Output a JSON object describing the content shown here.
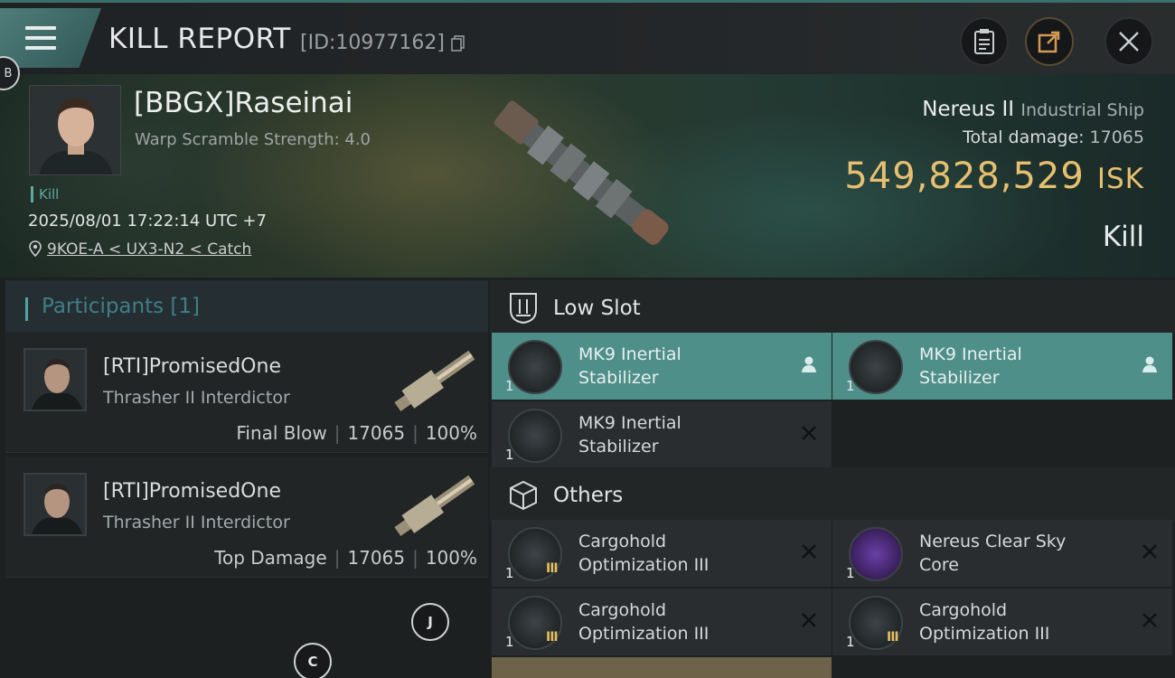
{
  "header": {
    "title": "KILL REPORT",
    "kill_id": "[ID:10977162]",
    "side_marker": "B"
  },
  "victim": {
    "name": "[BBGX]Raseinai",
    "warp_scramble": "Warp Scramble Strength: 4.0",
    "kill_tag": "Kill",
    "datetime": "2025/08/01 17:22:14 UTC +7",
    "location": "9KOE-A < UX3-N2 < Catch",
    "ship_name": "Nereus II",
    "ship_class": "Industrial Ship",
    "total_damage_label": "Total damage:",
    "total_damage": "17065",
    "isk_value": "549,828,529",
    "isk_unit": "ISK",
    "result": "Kill"
  },
  "participants": {
    "title": "Participants",
    "count": "[1]",
    "rows": [
      {
        "name": "[RTI]PromisedOne",
        "ship": "Thrasher II Interdictor",
        "role": "Final Blow",
        "damage": "17065",
        "percent": "100%"
      },
      {
        "name": "[RTI]PromisedOne",
        "ship": "Thrasher II Interdictor",
        "role": "Top Damage",
        "damage": "17065",
        "percent": "100%"
      }
    ],
    "floating_buttons": [
      "J",
      "C"
    ]
  },
  "fitting": {
    "low_slot": {
      "title": "Low Slot",
      "modules": [
        {
          "name_line1": "MK9 Inertial",
          "name_line2": "Stabilizer",
          "qty": "1",
          "state": "dropped"
        },
        {
          "name_line1": "MK9 Inertial",
          "name_line2": "Stabilizer",
          "qty": "1",
          "state": "dropped"
        },
        {
          "name_line1": "MK9 Inertial",
          "name_line2": "Stabilizer",
          "qty": "1",
          "state": "destroyed"
        }
      ]
    },
    "others": {
      "title": "Others",
      "modules": [
        {
          "name_line1": "Cargohold",
          "name_line2": "Optimization III",
          "qty": "1",
          "tier": "III",
          "state": "destroyed"
        },
        {
          "name_line1": "Nereus Clear Sky",
          "name_line2": "Core",
          "qty": "1",
          "state": "destroyed"
        },
        {
          "name_line1": "Cargohold",
          "name_line2": "Optimization III",
          "qty": "1",
          "tier": "III",
          "state": "destroyed"
        },
        {
          "name_line1": "Cargohold",
          "name_line2": "Optimization III",
          "qty": "1",
          "tier": "III",
          "state": "destroyed"
        }
      ]
    }
  },
  "colors": {
    "accent": "#4fa6a0",
    "isk": "#e6c070",
    "highlight_row": "#4e8f8a"
  },
  "icons": [
    "menu-icon",
    "copy-icon",
    "clipboard-icon",
    "share-icon",
    "close-icon",
    "location-pin-icon",
    "low-slot-icon",
    "others-cube-icon",
    "pilot-icon",
    "destroyed-x-icon"
  ]
}
